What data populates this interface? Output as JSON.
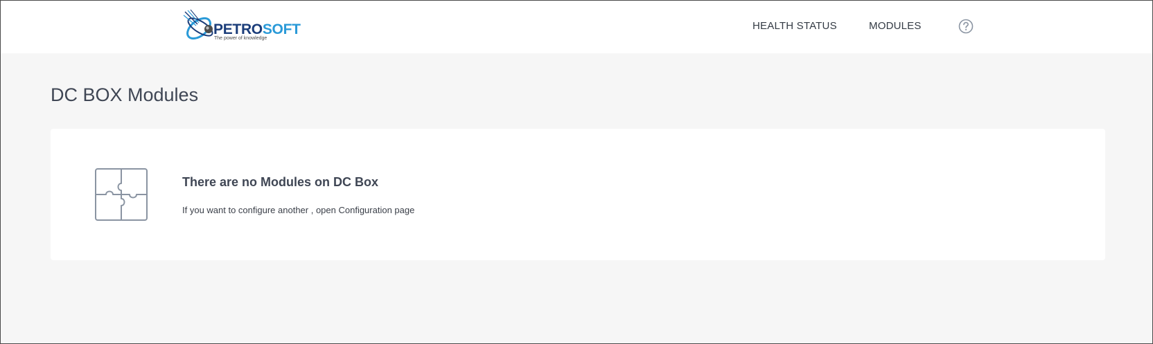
{
  "header": {
    "logo": {
      "word_part1": "PETRO",
      "word_part2": "SOFT",
      "tagline": "The power of knowledge"
    },
    "nav": {
      "health_status": "HEALTH STATUS",
      "modules": "MODULES"
    },
    "help_icon": "help-circle-icon"
  },
  "main": {
    "title": "DC BOX Modules",
    "empty_state": {
      "icon": "puzzle-icon",
      "title": "There are no Modules on DC Box",
      "message": "If you want to configure another , open Configuration page"
    }
  },
  "colors": {
    "brand_dark": "#1b3d7a",
    "brand_light": "#2a9ad8",
    "page_background": "#f6f6f6",
    "card_background": "#ffffff",
    "text": "#3f4654",
    "icon": "#8a94a2"
  }
}
